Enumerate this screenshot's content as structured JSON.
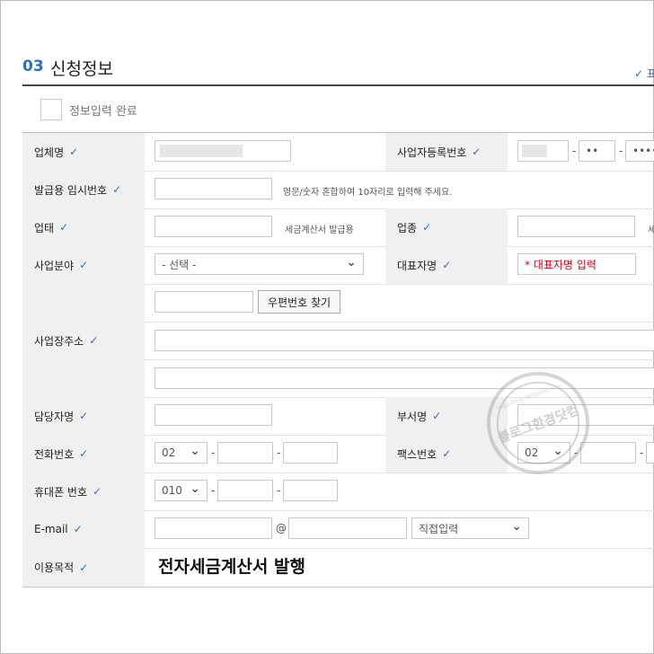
{
  "section": {
    "number": "03",
    "title": "신청정보",
    "required_note": "✓ 표시"
  },
  "done": {
    "label": "정보입력 완료"
  },
  "fields": {
    "company": {
      "label": "업체명"
    },
    "bizno": {
      "label": "사업자등록번호",
      "part2": "••",
      "part3": "•••••"
    },
    "tempno": {
      "label": "발급용 임시번호",
      "hint": "영문/숫자 혼합하여 10자리로 입력해 주세요."
    },
    "biztype": {
      "label": "업태",
      "hint": "세금계산서 발급용"
    },
    "bizitem": {
      "label": "업종",
      "hint": "세"
    },
    "field": {
      "label": "사업분야",
      "value": "- 선택 -"
    },
    "ceo": {
      "label": "대표자명",
      "placeholder": "* 대표자명 입력"
    },
    "address": {
      "label": "사업장주소",
      "zip_button": "우편번호 찾기"
    },
    "manager": {
      "label": "담당자명"
    },
    "dept": {
      "label": "부서명"
    },
    "phone": {
      "label": "전화번호",
      "area": "02"
    },
    "fax": {
      "label": "팩스번호",
      "area": "02"
    },
    "mobile": {
      "label": "휴대폰 번호",
      "prefix": "010"
    },
    "email": {
      "label": "E-mail",
      "at": "@",
      "domain_select": "직접입력"
    },
    "purpose": {
      "label": "이용목적",
      "value": "전자세금계산서 발행"
    }
  },
  "separators": {
    "dash": "-"
  },
  "watermark": {
    "text": "블로그한경닷컴",
    "url": "http://blog.hankyung.com"
  },
  "colors": {
    "accent": "#2f6fbf",
    "label_bg": "#f0f0f0",
    "required": "#d0021b"
  }
}
